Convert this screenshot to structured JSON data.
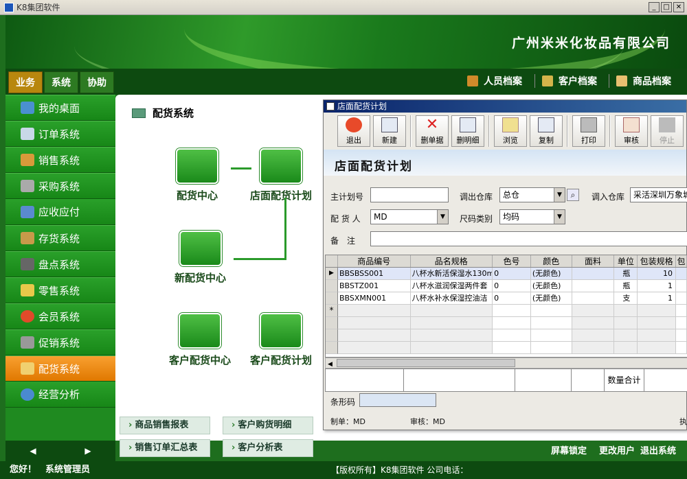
{
  "window": {
    "title": "K8集团软件"
  },
  "banner": {
    "company": "广州米米化妆品有限公司"
  },
  "menu": {
    "tabs": [
      "业务",
      "系统",
      "协助"
    ]
  },
  "quicklinks": [
    "人员档案",
    "客户档案",
    "商品档案"
  ],
  "sidebar": {
    "items": [
      "我的桌面",
      "订单系统",
      "销售系统",
      "采购系统",
      "应收应付",
      "存货系统",
      "盘点系统",
      "零售系统",
      "会员系统",
      "促销系统",
      "配货系统",
      "经营分析"
    ]
  },
  "nav": {
    "prev": "◀",
    "next": "▶"
  },
  "content": {
    "title": "配货系统",
    "flow": [
      "配货中心",
      "店面配货计划",
      "新配货中心",
      "客户配货中心",
      "客户配货计划"
    ]
  },
  "bottomnav": [
    "商品销售报表",
    "客户购货明细",
    "销售订单汇总表",
    "客户分析表"
  ],
  "bottomright": [
    "屏幕锁定",
    "更改用户",
    "退出系统"
  ],
  "status": {
    "left": "您好！　系统管理员",
    "center": "【版权所有】K8集团软件 公司电话："
  },
  "dialog": {
    "title": "店面配货计划",
    "toolbar": [
      "退出",
      "新建",
      "删单据",
      "删明细",
      "浏览",
      "复制",
      "打印",
      "审核",
      "停止"
    ],
    "header": "店面配货计划",
    "fields": {
      "main_plan_label": "主计划号",
      "main_plan_value": "",
      "out_wh_label": "调出仓库",
      "out_wh_value": "总仓",
      "in_wh_label": "调入仓库",
      "in_wh_value": "采活深圳万象城",
      "person_label": "配 货 人",
      "person_value": "MD",
      "size_label": "尺码类别",
      "size_value": "均码",
      "note_label": "备　注",
      "note_value": ""
    },
    "grid": {
      "columns": [
        "商品编号",
        "品名规格",
        "色号",
        "颜色",
        "面料",
        "单位",
        "包装规格",
        "包"
      ],
      "rows": [
        [
          "BBSBSS001",
          "八杯水新活保湿水130ml",
          "0",
          "(无颜色)",
          "",
          "瓶",
          "10",
          ""
        ],
        [
          "BBSTZ001",
          "八杯水滋润保湿两件套",
          "0",
          "(无颜色)",
          "",
          "瓶",
          "1",
          ""
        ],
        [
          "BBSXMN001",
          "八杯水补水保湿控油洁",
          "0",
          "(无颜色)",
          "",
          "支",
          "1",
          ""
        ]
      ],
      "new_row_marker": "*"
    },
    "totals_label": "数量合计",
    "barcode_label": "条形码",
    "maker": "制单：MD",
    "auditor": "审核：MD",
    "exec": "执"
  },
  "colors": {
    "green": "#1f8a20",
    "orange": "#e07800",
    "titleblue": "#0a246a"
  }
}
